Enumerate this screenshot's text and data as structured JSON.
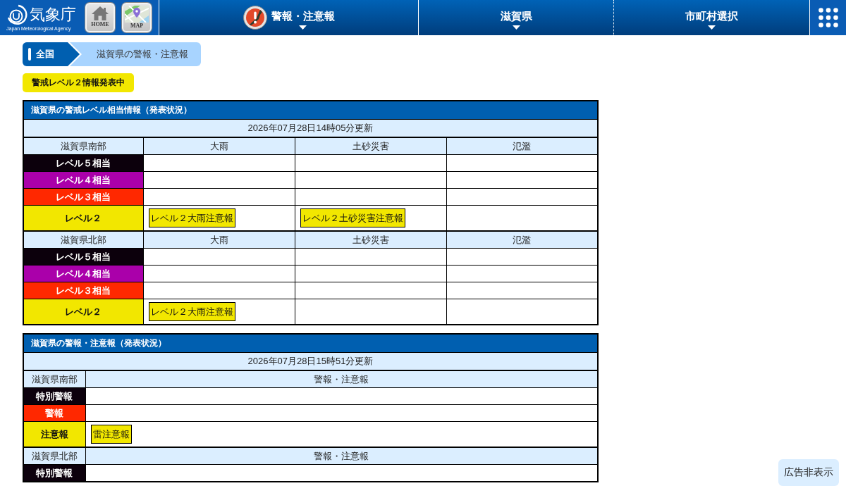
{
  "header": {
    "logo": {
      "title": "気象庁",
      "subtitle": "Japan Meteorological Agency"
    },
    "quick_links": [
      {
        "kind": "home",
        "label": "HOME"
      },
      {
        "kind": "map",
        "label": "MAP"
      }
    ],
    "nav": [
      {
        "kind": "warning",
        "label": "警報・注意報"
      },
      {
        "kind": "plain",
        "label": "滋賀県"
      },
      {
        "kind": "plain",
        "label": "市町村選択"
      }
    ]
  },
  "breadcrumb": [
    {
      "label": "全国",
      "selected": false
    },
    {
      "label": "滋賀県の警報・注意報",
      "selected": true
    }
  ],
  "status_badge": "警戒レベル２情報発表中",
  "level_table": {
    "title": "滋賀県の警戒レベル相当情報（発表状況）",
    "updated": "2026年07月28日14時05分更新",
    "sections": [
      {
        "region": "滋賀県南部",
        "columns": [
          "大雨",
          "土砂災害",
          "氾濫"
        ],
        "rows": [
          {
            "label": "レベル５相当",
            "color": "#0c000c",
            "cells": [
              {
                "issued": false
              },
              {
                "issued": false
              },
              {
                "issued": false
              }
            ]
          },
          {
            "label": "レベル４相当",
            "color": "#aa00aa",
            "cells": [
              {
                "issued": false
              },
              {
                "issued": false
              },
              {
                "issued": false
              }
            ]
          },
          {
            "label": "レベル３相当",
            "color": "#ff2800",
            "cells": [
              {
                "issued": false
              },
              {
                "issued": false
              },
              {
                "issued": false
              }
            ]
          },
          {
            "label": "レベル２",
            "color": "#f2e700",
            "cells": [
              {
                "issued": true,
                "warning": "レベル２大雨注意報"
              },
              {
                "issued": true,
                "warning": "レベル２土砂災害注意報"
              },
              {
                "issued": false
              }
            ]
          }
        ]
      },
      {
        "region": "滋賀県北部",
        "columns": [
          "大雨",
          "土砂災害",
          "氾濫"
        ],
        "rows": [
          {
            "label": "レベル５相当",
            "color": "#0c000c",
            "cells": [
              {
                "issued": false
              },
              {
                "issued": false
              },
              {
                "issued": false
              }
            ]
          },
          {
            "label": "レベル４相当",
            "color": "#aa00aa",
            "cells": [
              {
                "issued": false
              },
              {
                "issued": false
              },
              {
                "issued": false
              }
            ]
          },
          {
            "label": "レベル３相当",
            "color": "#ff2800",
            "cells": [
              {
                "issued": false
              },
              {
                "issued": false
              },
              {
                "issued": false
              }
            ]
          },
          {
            "label": "レベル２",
            "color": "#f2e700",
            "cells": [
              {
                "issued": true,
                "warning": "レベル２大雨注意報"
              },
              {
                "issued": false
              },
              {
                "issued": false
              }
            ]
          }
        ]
      }
    ]
  },
  "warning_table": {
    "title": "滋賀県の警報・注意報（発表状況）",
    "updated": "2026年07月28日15時51分更新",
    "sections": [
      {
        "region": "滋賀県南部",
        "column": "警報・注意報",
        "rows": [
          {
            "label": "特別警報",
            "color": "#0c000c"
          },
          {
            "label": "警報",
            "color": "#ff2800"
          },
          {
            "label": "注意報",
            "color": "#f2e700",
            "warnings": [
              "雷注意報"
            ]
          }
        ]
      },
      {
        "region": "滋賀県北部",
        "column": "警報・注意報",
        "rows": [
          {
            "label": "特別警報",
            "color": "#0c000c"
          }
        ]
      }
    ]
  },
  "ad_toggle": "広告非表示"
}
